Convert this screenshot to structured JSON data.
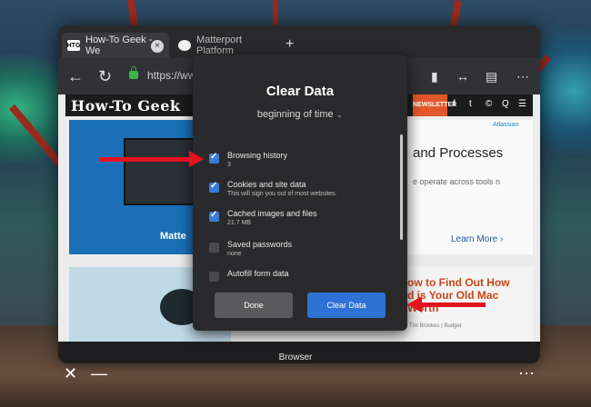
{
  "browser": {
    "tabs": [
      {
        "favicon": "HTG",
        "title": "How-To Geek - We",
        "close": "×"
      },
      {
        "favicon": "",
        "title": "Matterport Platform",
        "close": ""
      }
    ],
    "new_tab": "+",
    "url": "https://www",
    "site": {
      "logo": "How-To Geek",
      "newsletter": "NEWSLETTER",
      "social": [
        "f",
        "t",
        "©",
        "Q"
      ]
    },
    "cards": {
      "left_brand": "Matte",
      "right_title": "and Processes",
      "right_sub": "e operate across tools n",
      "right_learn": "Learn More",
      "right_logo": "Atlassian",
      "right2_title": "ow to Find Out How\nd is Your Old Mac\nWorth",
      "right2_author": "Tim Brookes   |   Budget"
    },
    "label": "Browser"
  },
  "dialog": {
    "title": "Clear Data",
    "time_range": "beginning of time",
    "options": [
      {
        "label": "Browsing history",
        "sub": "3",
        "checked": true
      },
      {
        "label": "Cookies and site data",
        "sub": "This will sign you out of most websites.",
        "checked": true
      },
      {
        "label": "Cached images and files",
        "sub": "21.7 MB",
        "checked": true
      },
      {
        "label": "Saved passwords",
        "sub": "none",
        "checked": false
      },
      {
        "label": "Autofill form data",
        "sub": "",
        "checked": false
      }
    ],
    "done_label": "Done",
    "clear_label": "Clear Data"
  },
  "colors": {
    "accent": "#2e72d6",
    "annotation_arrow": "#e4131f",
    "dialog_bg": "#2a2a2c"
  }
}
